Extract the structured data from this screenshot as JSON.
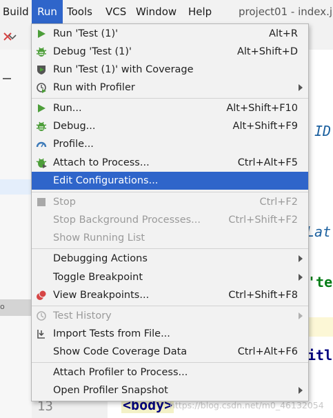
{
  "menubar": {
    "items": [
      {
        "label": "Build"
      },
      {
        "label": "Run",
        "active": true
      },
      {
        "label": "Tools"
      },
      {
        "label": "VCS"
      },
      {
        "label": "Window"
      },
      {
        "label": "Help"
      }
    ],
    "window_title": "project01 - index.js"
  },
  "editor": {
    "fragments": [
      "ID",
      "Lat",
      "'te",
      "itl"
    ],
    "line_number": "13",
    "code_line": "<body>"
  },
  "left_panel": {
    "label": "o"
  },
  "watermark": "https://blog.csdn.net/m0_46132054",
  "run_menu": {
    "items": [
      {
        "label": "Run 'Test (1)'",
        "shortcut": "Alt+R",
        "icon": "run-icon"
      },
      {
        "label": "Debug 'Test (1)'",
        "shortcut": "Alt+Shift+D",
        "icon": "debug-icon"
      },
      {
        "label": "Run 'Test (1)' with Coverage",
        "shortcut": "",
        "icon": "coverage-icon"
      },
      {
        "label": "Run with Profiler",
        "shortcut": "",
        "icon": "profiler-icon",
        "submenu": true
      },
      {
        "label": "Run...",
        "shortcut": "Alt+Shift+F10",
        "icon": "run-icon"
      },
      {
        "label": "Debug...",
        "shortcut": "Alt+Shift+F9",
        "icon": "debug-icon"
      },
      {
        "label": "Profile...",
        "shortcut": "",
        "icon": "gauge-icon"
      },
      {
        "label": "Attach to Process...",
        "shortcut": "Ctrl+Alt+F5",
        "icon": "attach-icon"
      },
      {
        "label": "Edit Configurations...",
        "shortcut": "",
        "icon": "",
        "highlighted": true
      },
      {
        "label": "Stop",
        "shortcut": "Ctrl+F2",
        "icon": "stop-icon",
        "disabled": true
      },
      {
        "label": "Stop Background Processes...",
        "shortcut": "Ctrl+Shift+F2",
        "icon": "",
        "disabled": true
      },
      {
        "label": "Show Running List",
        "shortcut": "",
        "icon": "",
        "disabled": true
      },
      {
        "label": "Debugging Actions",
        "shortcut": "",
        "icon": "",
        "submenu": true
      },
      {
        "label": "Toggle Breakpoint",
        "shortcut": "",
        "icon": "",
        "submenu": true
      },
      {
        "label": "View Breakpoints...",
        "shortcut": "Ctrl+Shift+F8",
        "icon": "breakpoints-icon"
      },
      {
        "label": "Test History",
        "shortcut": "",
        "icon": "history-icon",
        "submenu": true,
        "disabled": true
      },
      {
        "label": "Import Tests from File...",
        "shortcut": "",
        "icon": "import-icon"
      },
      {
        "label": "Show Code Coverage Data",
        "shortcut": "Ctrl+Alt+F6",
        "icon": ""
      },
      {
        "label": "Attach Profiler to Process...",
        "shortcut": "",
        "icon": ""
      },
      {
        "label": "Open Profiler Snapshot",
        "shortcut": "",
        "icon": "",
        "submenu": true
      }
    ]
  },
  "colors": {
    "accent": "#2f65ca",
    "run_green": "#4d9e3a",
    "debug_red": "#d64545"
  }
}
